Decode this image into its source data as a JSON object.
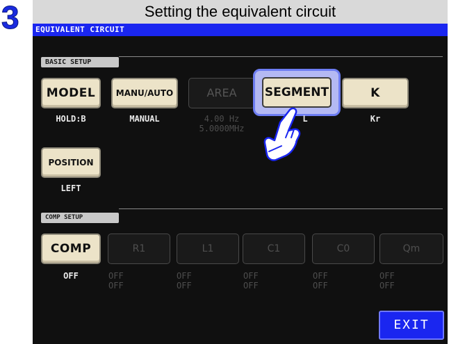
{
  "step": {
    "number": "3",
    "heading": "Setting the equivalent circuit"
  },
  "window": {
    "title": "EQUIVALENT CIRCUIT"
  },
  "basic_setup": {
    "section_label": "BASIC SETUP",
    "buttons": {
      "model": {
        "label": "MODEL",
        "value": "HOLD:B"
      },
      "manu_auto": {
        "label": "MANU/AUTO",
        "value": "MANUAL"
      },
      "area": {
        "label": "AREA",
        "value_line1": "4.00 Hz",
        "value_line2": "5.0000MHz"
      },
      "segment": {
        "label": "SEGMENT",
        "value": "L"
      },
      "k": {
        "label": "K",
        "value": "Kr"
      },
      "position": {
        "label": "POSITION",
        "value": "LEFT"
      }
    }
  },
  "comp_setup": {
    "section_label": "COMP SETUP",
    "comp": {
      "label": "COMP",
      "value": "OFF"
    },
    "params": [
      {
        "label": "R1",
        "line1": "OFF",
        "line2": "OFF"
      },
      {
        "label": "L1",
        "line1": "OFF",
        "line2": "OFF"
      },
      {
        "label": "C1",
        "line1": "OFF",
        "line2": "OFF"
      },
      {
        "label": "C0",
        "line1": "OFF",
        "line2": "OFF"
      },
      {
        "label": "Qm",
        "line1": "OFF",
        "line2": "OFF"
      }
    ]
  },
  "exit_label": "EXIT",
  "colors": {
    "accent_blue": "#1a26f0",
    "button_face": "#ece3c8",
    "highlight": "#b4b9f3",
    "step_number": "#1a2be0"
  },
  "icons": {
    "pointer": "pointing-hand-icon"
  }
}
